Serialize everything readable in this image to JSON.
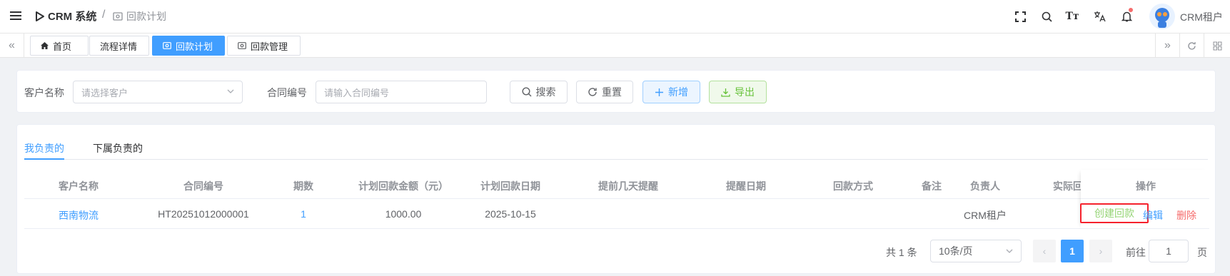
{
  "app": {
    "title": "CRM 系统",
    "breadcrumb": "回款计划",
    "username": "CRM租户"
  },
  "tabs": [
    {
      "label": "首页",
      "icon": "home-icon",
      "active": false
    },
    {
      "label": "流程详情",
      "icon": "",
      "active": false
    },
    {
      "label": "回款计划",
      "icon": "money-icon",
      "active": true
    },
    {
      "label": "回款管理",
      "icon": "money-icon",
      "active": false
    }
  ],
  "filter": {
    "customer_label": "客户名称",
    "customer_placeholder": "请选择客户",
    "contract_label": "合同编号",
    "contract_placeholder": "请输入合同编号",
    "search_label": "搜索",
    "reset_label": "重置",
    "add_label": "新增",
    "export_label": "导出"
  },
  "subtabs": [
    "我负责的",
    "下属负责的"
  ],
  "table": {
    "columns": [
      "客户名称",
      "合同编号",
      "期数",
      "计划回款金额（元）",
      "计划回款日期",
      "提前几天提醒",
      "提醒日期",
      "回款方式",
      "备注",
      "负责人",
      "实际回",
      "操作"
    ],
    "rows": [
      {
        "customer": "西南物流",
        "contract": "HT20251012000001",
        "period": "1",
        "amount": "1000.00",
        "date": "2025-10-15",
        "remind_days": "",
        "remind_date": "",
        "method": "",
        "remark": "",
        "owner": "CRM租户",
        "actual": ""
      }
    ],
    "actions": {
      "create": "创建回款",
      "edit": "编辑",
      "delete": "删除"
    }
  },
  "pagination": {
    "total_text": "共 1 条",
    "page_size": "10条/页",
    "current_page": "1",
    "goto_label": "前往",
    "goto_value": "1",
    "page_suffix": "页"
  },
  "colors": {
    "primary": "#409eff",
    "danger": "#f56c6c",
    "success": "#67c23a",
    "highlight_box": "#f5222d"
  }
}
